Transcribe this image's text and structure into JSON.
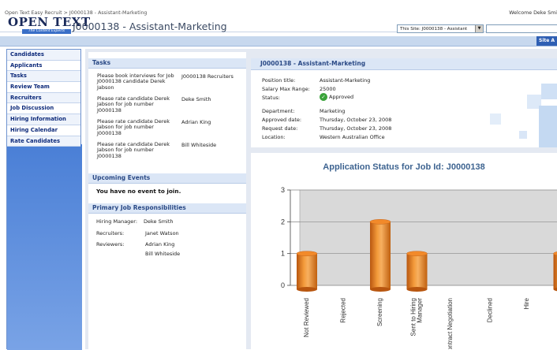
{
  "header": {
    "breadcrumb": "Open Text Easy Recruit > J0000138 - Assistant-Marketing",
    "welcome": "Welcome Deke Smi",
    "logo_text": "OPEN TEXT",
    "logo_tagline": "The Content Experts",
    "page_title": "J0000138 - Assistant-Marketing",
    "site_scope": "This Site: J0000138 - Assistant",
    "site_actions": "Site A"
  },
  "sidebar": {
    "items": [
      {
        "label": "Candidates"
      },
      {
        "label": "Applicants"
      },
      {
        "label": "Tasks"
      },
      {
        "label": "Review Team"
      },
      {
        "label": "Recruiters"
      },
      {
        "label": "Job Discussion"
      },
      {
        "label": "Hiring Information"
      },
      {
        "label": "Hiring Calendar"
      },
      {
        "label": "Rate Candidates"
      }
    ]
  },
  "tasks": {
    "heading": "Tasks",
    "items": [
      {
        "description": "Please book interviews for Job J0000138 candidate Derek Jabson",
        "assignee": "J0000138 Recruiters"
      },
      {
        "description": "Please rate candidate Derek Jabson for job number J0000138",
        "assignee": "Deke Smith"
      },
      {
        "description": "Please rate candidate Derek Jabson for job number J0000138",
        "assignee": "Adrian King"
      },
      {
        "description": "Please rate candidate Derek Jabson for job number J0000138",
        "assignee": "Bill Whiteside"
      }
    ]
  },
  "events": {
    "heading": "Upcoming Events",
    "empty_text": "You have no event to join."
  },
  "responsibilities": {
    "heading": "Primary Job Responsibilities",
    "hiring_manager_label": "Hiring Manager:",
    "hiring_manager": "Deke Smith",
    "recruiters_label": "Recruiters:",
    "recruiters": "Janet Watson",
    "reviewers_label": "Reviewers:",
    "reviewers": [
      "Adrian King",
      "Bill Whiteside"
    ]
  },
  "job": {
    "title": "J0000138 - Assistant-Marketing",
    "position_label": "Position title:",
    "position": "Assistant-Marketing",
    "salary_label": "Salary Max Range:",
    "salary": "25000",
    "status_label": "Status:",
    "status": "Approved",
    "department_label": "Department:",
    "department": "Marketing",
    "approved_label": "Approved date:",
    "approved": "Thursday, October 23, 2008",
    "request_label": "Request date:",
    "request": "Thursday, October 23, 2008",
    "location_label": "Location:",
    "location": "Western Australian Office"
  },
  "chart_data": {
    "type": "bar",
    "title": "Application Status for Job Id: J0000138",
    "categories": [
      "Not Reviewed",
      "Rejected",
      "Screening",
      "Sent to Hiring Manager",
      "Contract Negotiation",
      "Declined",
      "Hire",
      ""
    ],
    "values": [
      1,
      0,
      2,
      1,
      0,
      0,
      0,
      1
    ],
    "ylim": [
      0,
      3
    ],
    "yticks": [
      "0",
      "1",
      "2",
      "3"
    ],
    "grid": true,
    "bar_color": "#e8801e"
  }
}
